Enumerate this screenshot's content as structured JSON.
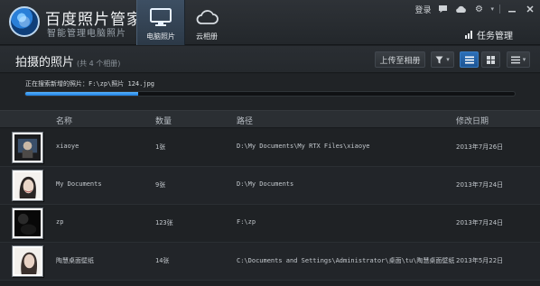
{
  "app": {
    "title": "百度照片管家",
    "subtitle": "智能管理电脑照片"
  },
  "nav": {
    "tabs": [
      {
        "label": "电脑照片",
        "active": true
      },
      {
        "label": "云相册",
        "active": false
      }
    ]
  },
  "top_right": {
    "login": "登录",
    "task_manager": "任务管理"
  },
  "toolbar": {
    "title": "拍摄的照片",
    "count_text": "(共 4 个相册)",
    "upload_label": "上传至相册"
  },
  "progress": {
    "text": "正在搜索新增的照片：F:\\zp\\照片 124.jpg",
    "value": 0.23
  },
  "table": {
    "headers": {
      "name": "名称",
      "count": "数量",
      "path": "路径",
      "date": "修改日期"
    },
    "rows": [
      {
        "name": "xiaoye",
        "count": "1张",
        "path": "D:\\My Documents\\My RTX Files\\xiaoye",
        "date": "2013年7月26日"
      },
      {
        "name": "My Documents",
        "count": "9张",
        "path": "D:\\My Documents",
        "date": "2013年7月24日"
      },
      {
        "name": "zp",
        "count": "123张",
        "path": "F:\\zp",
        "date": "2013年7月24日"
      },
      {
        "name": "陶慧桌面壁纸",
        "count": "14张",
        "path": "C:\\Documents and Settings\\Administrator\\桌面\\tu\\陶慧桌面壁纸",
        "date": "2013年5月22日"
      }
    ]
  },
  "colors": {
    "accent": "#2a86e8",
    "background": "#1e2124"
  },
  "icons": [
    "monitor-icon",
    "cloud-icon",
    "message-icon",
    "cloud-download-icon",
    "settings-icon",
    "minimize-icon",
    "close-icon",
    "filter-icon",
    "list-view-icon",
    "grid-view-icon",
    "menu-icon"
  ]
}
